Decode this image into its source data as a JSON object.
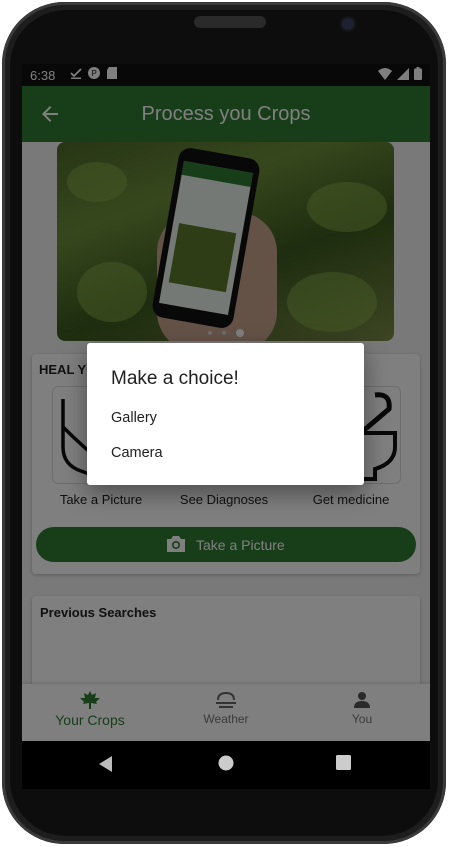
{
  "status_bar": {
    "time": "6:38"
  },
  "app_bar": {
    "title": "Process you Crops"
  },
  "heal_section": {
    "title": "HEAL YOUR CROP",
    "steps": [
      {
        "label": "Take a Picture"
      },
      {
        "label": "See Diagnoses"
      },
      {
        "label": "Get medicine"
      }
    ],
    "action_button": "Take a Picture"
  },
  "previous_searches": {
    "title": "Previous Searches"
  },
  "bottom_nav": {
    "items": [
      {
        "label": "Your Crops",
        "icon": "maple-leaf-icon",
        "active": true
      },
      {
        "label": "Weather",
        "icon": "weather-icon",
        "active": false
      },
      {
        "label": "You",
        "icon": "person-icon",
        "active": false
      }
    ]
  },
  "dialog": {
    "title": "Make a choice!",
    "options": [
      "Gallery",
      "Camera"
    ]
  },
  "colors": {
    "primary": "#2e7d32",
    "scrim": "rgba(0,0,0,0.5)"
  }
}
